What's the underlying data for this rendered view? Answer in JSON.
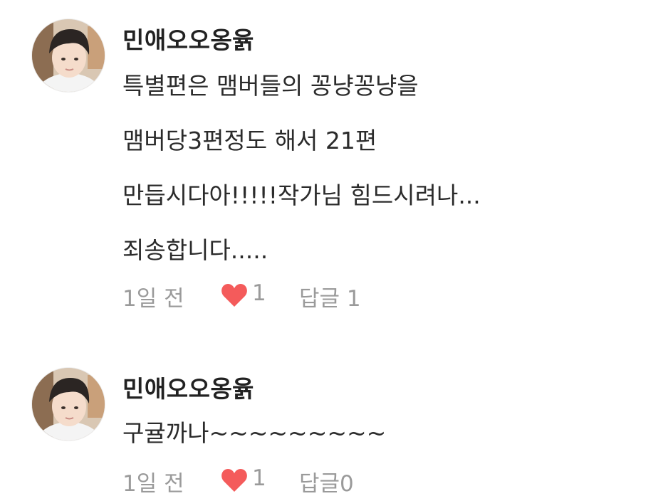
{
  "comments": [
    {
      "username": "민애오오옹윩",
      "lines": [
        "특별편은 맴버들의 꽁냥꽁냥을",
        "맴버당3편정도 해서 21편",
        "만듭시다아!!!!!작가님 힘드시려나...",
        "죄송합니다....."
      ],
      "time": "1일 전",
      "likes": "1",
      "reply_label": "답글 1"
    },
    {
      "username": "민애오오옹윩",
      "lines": [
        "구귤까나~~~~~~~~~"
      ],
      "time": "1일 전",
      "likes": "1",
      "reply_label": "답글0"
    }
  ],
  "icons": {
    "like": "heart-icon",
    "avatar": "profile-photo"
  },
  "colors": {
    "heart": "#f45b5b",
    "meta_text": "#9a9a9a",
    "username": "#222222",
    "body_text": "#2b2b2b"
  }
}
